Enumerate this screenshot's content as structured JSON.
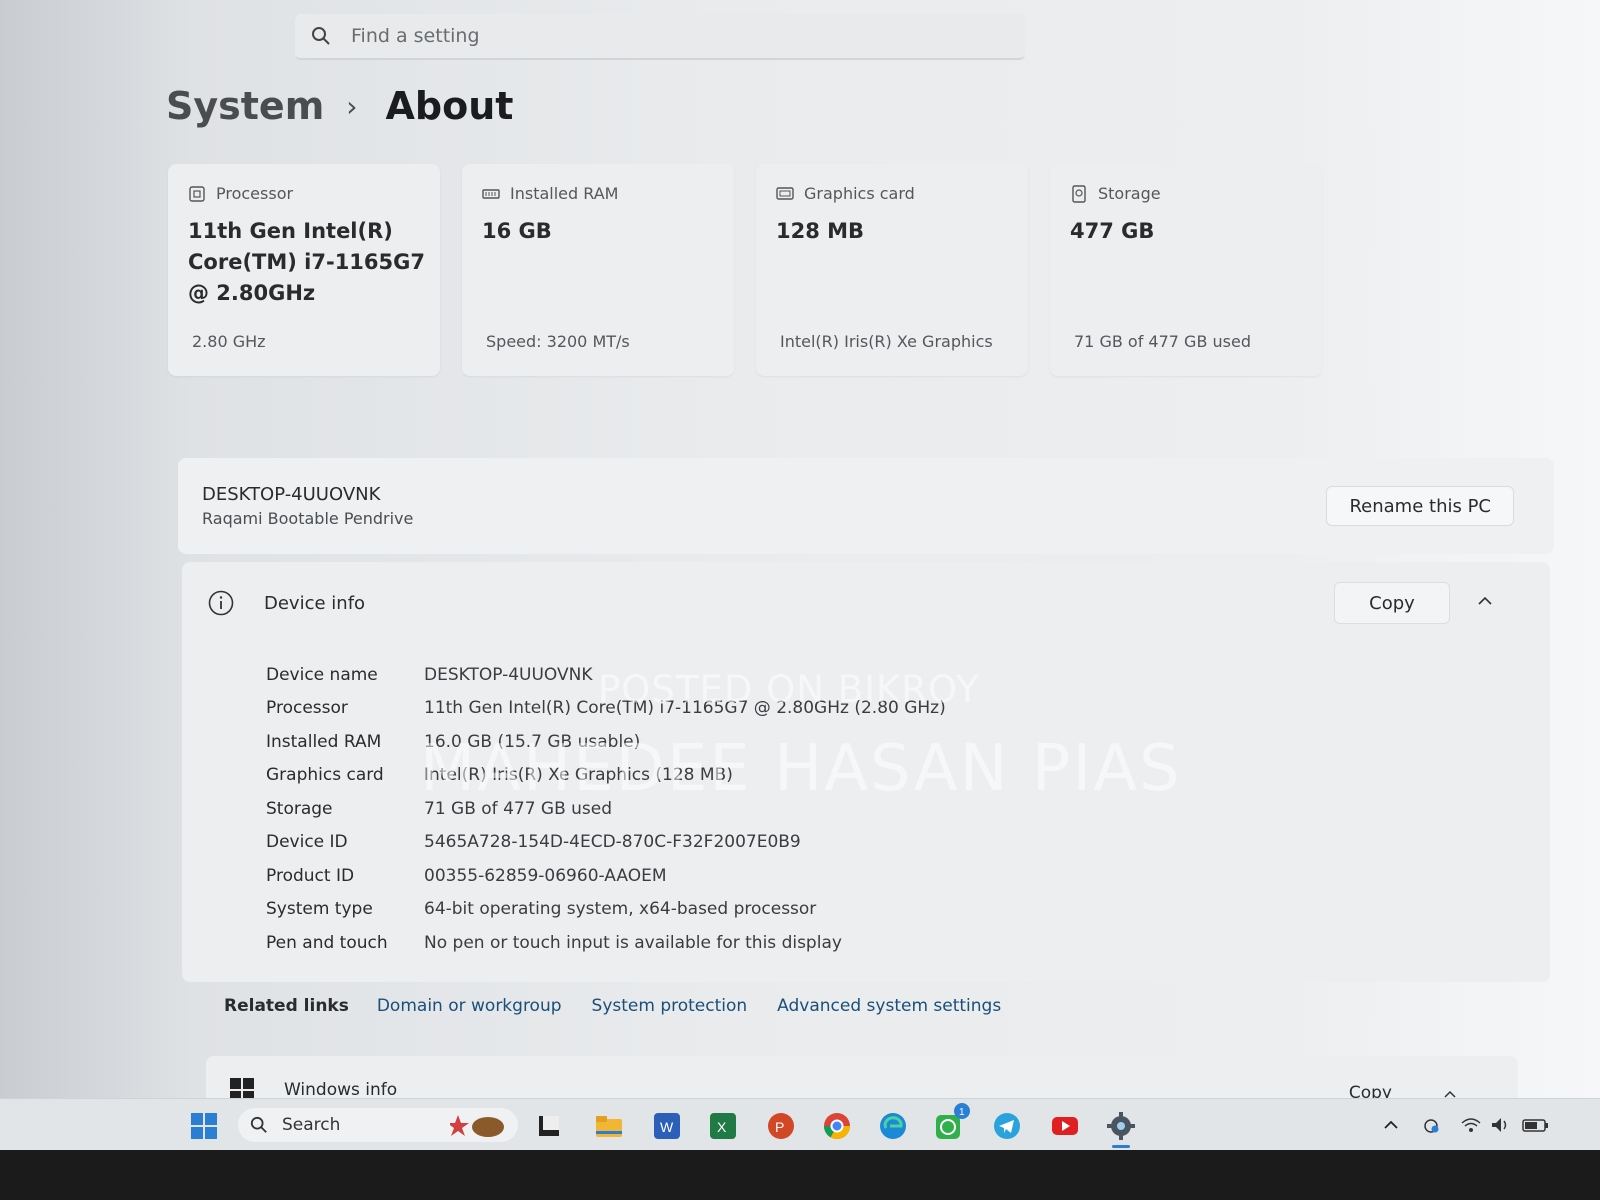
{
  "search": {
    "placeholder": "Find a setting"
  },
  "breadcrumb": {
    "parent": "System",
    "separator": "›",
    "current": "About"
  },
  "cards": [
    {
      "label": "Processor",
      "icon": "processor-icon",
      "value": "11th Gen Intel(R) Core(TM) i7-1165G7 @ 2.80GHz",
      "sub": "2.80 GHz"
    },
    {
      "label": "Installed RAM",
      "icon": "ram-icon",
      "value": "16 GB",
      "sub": "Speed: 3200 MT/s"
    },
    {
      "label": "Graphics card",
      "icon": "graphics-card-icon",
      "value": "128 MB",
      "sub": "Intel(R) Iris(R) Xe Graphics"
    },
    {
      "label": "Storage",
      "icon": "storage-icon",
      "value": "477 GB",
      "sub": "71 GB of 477 GB used"
    }
  ],
  "pc": {
    "name": "DESKTOP-4UUOVNK",
    "description": "Raqami Bootable Pendrive",
    "rename_label": "Rename this PC"
  },
  "device_info": {
    "title": "Device info",
    "copy_label": "Copy",
    "rows": [
      {
        "label": "Device name",
        "value": "DESKTOP-4UUOVNK"
      },
      {
        "label": "Processor",
        "value": "11th Gen Intel(R) Core(TM) i7-1165G7 @ 2.80GHz (2.80 GHz)"
      },
      {
        "label": "Installed RAM",
        "value": "16.0 GB (15.7 GB usable)"
      },
      {
        "label": "Graphics card",
        "value": "Intel(R) Iris(R) Xe Graphics (128 MB)"
      },
      {
        "label": "Storage",
        "value": "71 GB of 477 GB used"
      },
      {
        "label": "Device ID",
        "value": "5465A728-154D-4ECD-870C-F32F2007E0B9"
      },
      {
        "label": "Product ID",
        "value": "00355-62859-06960-AAOEM"
      },
      {
        "label": "System type",
        "value": "64-bit operating system, x64-based processor"
      },
      {
        "label": "Pen and touch",
        "value": "No pen or touch input is available for this display"
      }
    ]
  },
  "related": {
    "title": "Related links",
    "links": [
      "Domain or workgroup",
      "System protection",
      "Advanced system settings"
    ]
  },
  "windows_info": {
    "title": "Windows info",
    "copy_label": "Copy"
  },
  "watermark": {
    "line1": "POSTED ON BIKROY",
    "line2": "MAHEDEE HASAN PIAS"
  },
  "taskbar": {
    "search_label": "Search",
    "apps": [
      "widgets",
      "file-manager",
      "folder",
      "word",
      "excel",
      "powerpoint",
      "chrome",
      "edge",
      "whatsapp",
      "telegram",
      "youtube",
      "settings"
    ],
    "whatsapp_badge": "1"
  },
  "colors": {
    "accent_link": "#1a4f7a",
    "card_bg": "#eceef0"
  }
}
